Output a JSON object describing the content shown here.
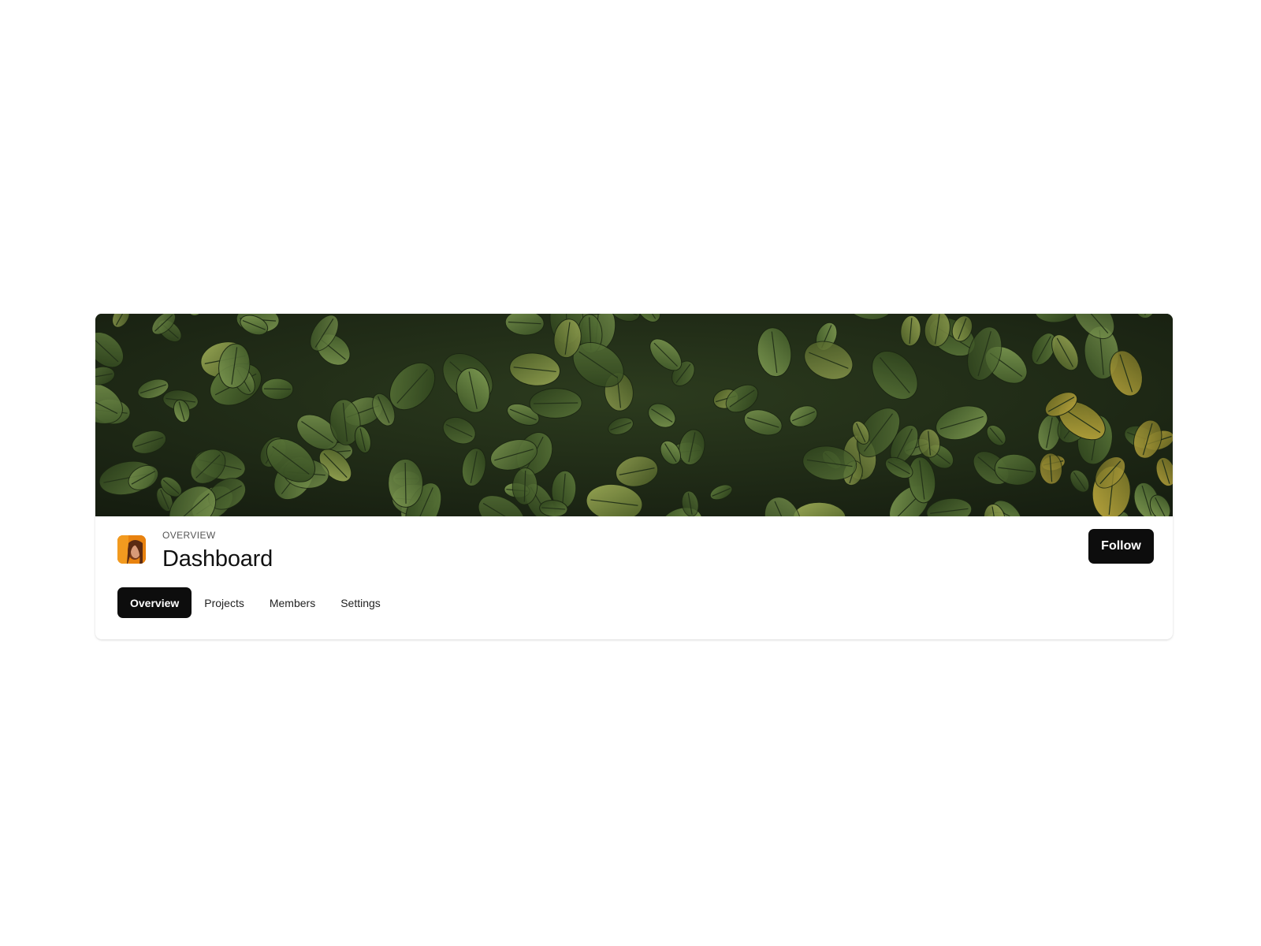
{
  "header": {
    "eyebrow": "OVERVIEW",
    "title": "Dashboard",
    "follow_label": "Follow"
  },
  "tabs": [
    {
      "label": "Overview",
      "active": true
    },
    {
      "label": "Projects",
      "active": false
    },
    {
      "label": "Members",
      "active": false
    },
    {
      "label": "Settings",
      "active": false
    }
  ],
  "colors": {
    "accent": "#0d0d0d",
    "avatar": "#e8820f",
    "banner": "#2f4020"
  },
  "icons": {
    "avatar": "user-avatar-image",
    "banner": "leaves-cover-image"
  }
}
